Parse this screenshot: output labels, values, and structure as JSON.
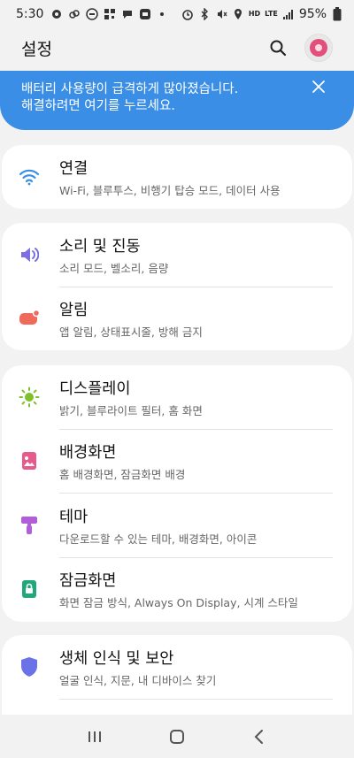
{
  "status_bar": {
    "time": "5:30",
    "network": "HD",
    "lte": "LTE",
    "battery": "95%"
  },
  "header": {
    "title": "설정"
  },
  "banner": {
    "line1": "배터리 사용량이 급격하게 많아졌습니다.",
    "line2": "해결하려면 여기를 누르세요."
  },
  "groups": [
    {
      "items": [
        {
          "title": "연결",
          "subtitle": "Wi-Fi, 블루투스, 비행기 탑승 모드, 데이터 사용",
          "icon": "wifi-icon",
          "color": "#3b8ee8"
        }
      ]
    },
    {
      "items": [
        {
          "title": "소리 및 진동",
          "subtitle": "소리 모드, 벨소리, 음량",
          "icon": "volume-icon",
          "color": "#7b6ee0"
        },
        {
          "title": "알림",
          "subtitle": "앱 알림, 상태표시줄, 방해 금지",
          "icon": "notification-icon",
          "color": "#ef6a5a"
        }
      ]
    },
    {
      "items": [
        {
          "title": "디스플레이",
          "subtitle": "밝기, 블루라이트 필터, 홈 화면",
          "icon": "brightness-icon",
          "color": "#7fc12b"
        },
        {
          "title": "배경화면",
          "subtitle": "홈 배경화면, 잠금화면 배경",
          "icon": "wallpaper-icon",
          "color": "#e75a8c"
        },
        {
          "title": "테마",
          "subtitle": "다운로드할 수 있는 테마, 배경화면, 아이콘",
          "icon": "theme-brush-icon",
          "color": "#b05fd8"
        },
        {
          "title": "잠금화면",
          "subtitle": "화면 잠금 방식, Always On Display, 시계 스타일",
          "icon": "lock-screen-icon",
          "color": "#21a87a"
        }
      ]
    },
    {
      "items": [
        {
          "title": "생체 인식 및 보안",
          "subtitle": "얼굴 인식, 지문, 내 디바이스 찾기",
          "icon": "shield-icon",
          "color": "#6b72e8"
        }
      ]
    }
  ]
}
